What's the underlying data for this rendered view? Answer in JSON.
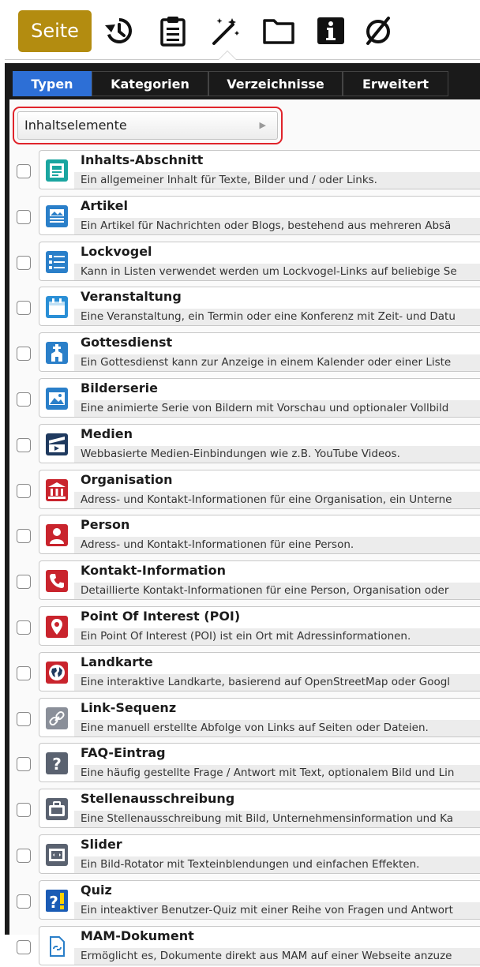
{
  "toolbar": {
    "seite_label": "Seite",
    "icons": [
      "history-icon",
      "clipboard-icon",
      "magic-wand-icon",
      "folder-icon",
      "info-icon",
      "no-entry-icon"
    ]
  },
  "tabs": [
    {
      "label": "Typen",
      "active": true
    },
    {
      "label": "Kategorien",
      "active": false
    },
    {
      "label": "Verzeichnisse",
      "active": false
    },
    {
      "label": "Erweitert",
      "active": false
    }
  ],
  "dropdown": {
    "value": "Inhaltselemente"
  },
  "items": [
    {
      "title": "Inhalts-Abschnitt",
      "desc": "Ein allgemeiner Inhalt für Texte, Bilder und / oder Links.",
      "icon": "content-section-icon"
    },
    {
      "title": "Artikel",
      "desc": "Ein Artikel für Nachrichten oder Blogs, bestehend aus mehreren Absä",
      "icon": "article-icon"
    },
    {
      "title": "Lockvogel",
      "desc": "Kann in Listen verwendet werden um Lockvogel-Links auf beliebige Se",
      "icon": "list-icon"
    },
    {
      "title": "Veranstaltung",
      "desc": "Eine Veranstaltung, ein Termin oder eine Konferenz mit Zeit- und Datu",
      "icon": "calendar-icon"
    },
    {
      "title": "Gottesdienst",
      "desc": "Ein Gottesdienst kann zur Anzeige in einem Kalender oder einer Liste",
      "icon": "church-icon"
    },
    {
      "title": "Bilderserie",
      "desc": "Eine animierte Serie von Bildern mit Vorschau und optionaler Vollbild",
      "icon": "image-icon"
    },
    {
      "title": "Medien",
      "desc": "Webbasierte Medien-Einbindungen wie z.B. YouTube Videos.",
      "icon": "media-icon"
    },
    {
      "title": "Organisation",
      "desc": "Adress- und Kontakt-Informationen für eine Organisation, ein Unterne",
      "icon": "bank-icon"
    },
    {
      "title": "Person",
      "desc": "Adress- und Kontakt-Informationen für eine Person.",
      "icon": "person-icon"
    },
    {
      "title": "Kontakt-Information",
      "desc": "Detaillierte Kontakt-Informationen für eine Person, Organisation oder",
      "icon": "phone-icon"
    },
    {
      "title": "Point Of Interest (POI)",
      "desc": "Ein Point Of Interest (POI) ist ein Ort mit Adressinformationen.",
      "icon": "map-pin-icon"
    },
    {
      "title": "Landkarte",
      "desc": "Eine interaktive Landkarte, basierend auf OpenStreetMap oder Googl",
      "icon": "globe-icon"
    },
    {
      "title": "Link-Sequenz",
      "desc": "Eine manuell erstellte Abfolge von Links auf Seiten oder Dateien.",
      "icon": "link-icon"
    },
    {
      "title": "FAQ-Eintrag",
      "desc": "Eine häufig gestellte Frage / Antwort mit Text, optionalem Bild und Lin",
      "icon": "question-icon"
    },
    {
      "title": "Stellenausschreibung",
      "desc": "Eine Stellenausschreibung mit Bild, Unternehmensinformation und Ka",
      "icon": "briefcase-icon"
    },
    {
      "title": "Slider",
      "desc": "Ein Bild-Rotator mit Texteinblendungen und einfachen Effekten.",
      "icon": "slider-icon"
    },
    {
      "title": "Quiz",
      "desc": "Ein inteaktiver Benutzer-Quiz mit einer Reihe von Fragen und Antwort",
      "icon": "quiz-icon"
    },
    {
      "title": "MAM-Dokument",
      "desc": "Ermöglicht es, Dokumente direkt aus MAM auf einer Webseite anzuze",
      "icon": "document-link-icon"
    }
  ],
  "colors": {
    "brand": "#b38c10",
    "tab_active": "#2d6fd6",
    "highlight": "#e0242b"
  }
}
